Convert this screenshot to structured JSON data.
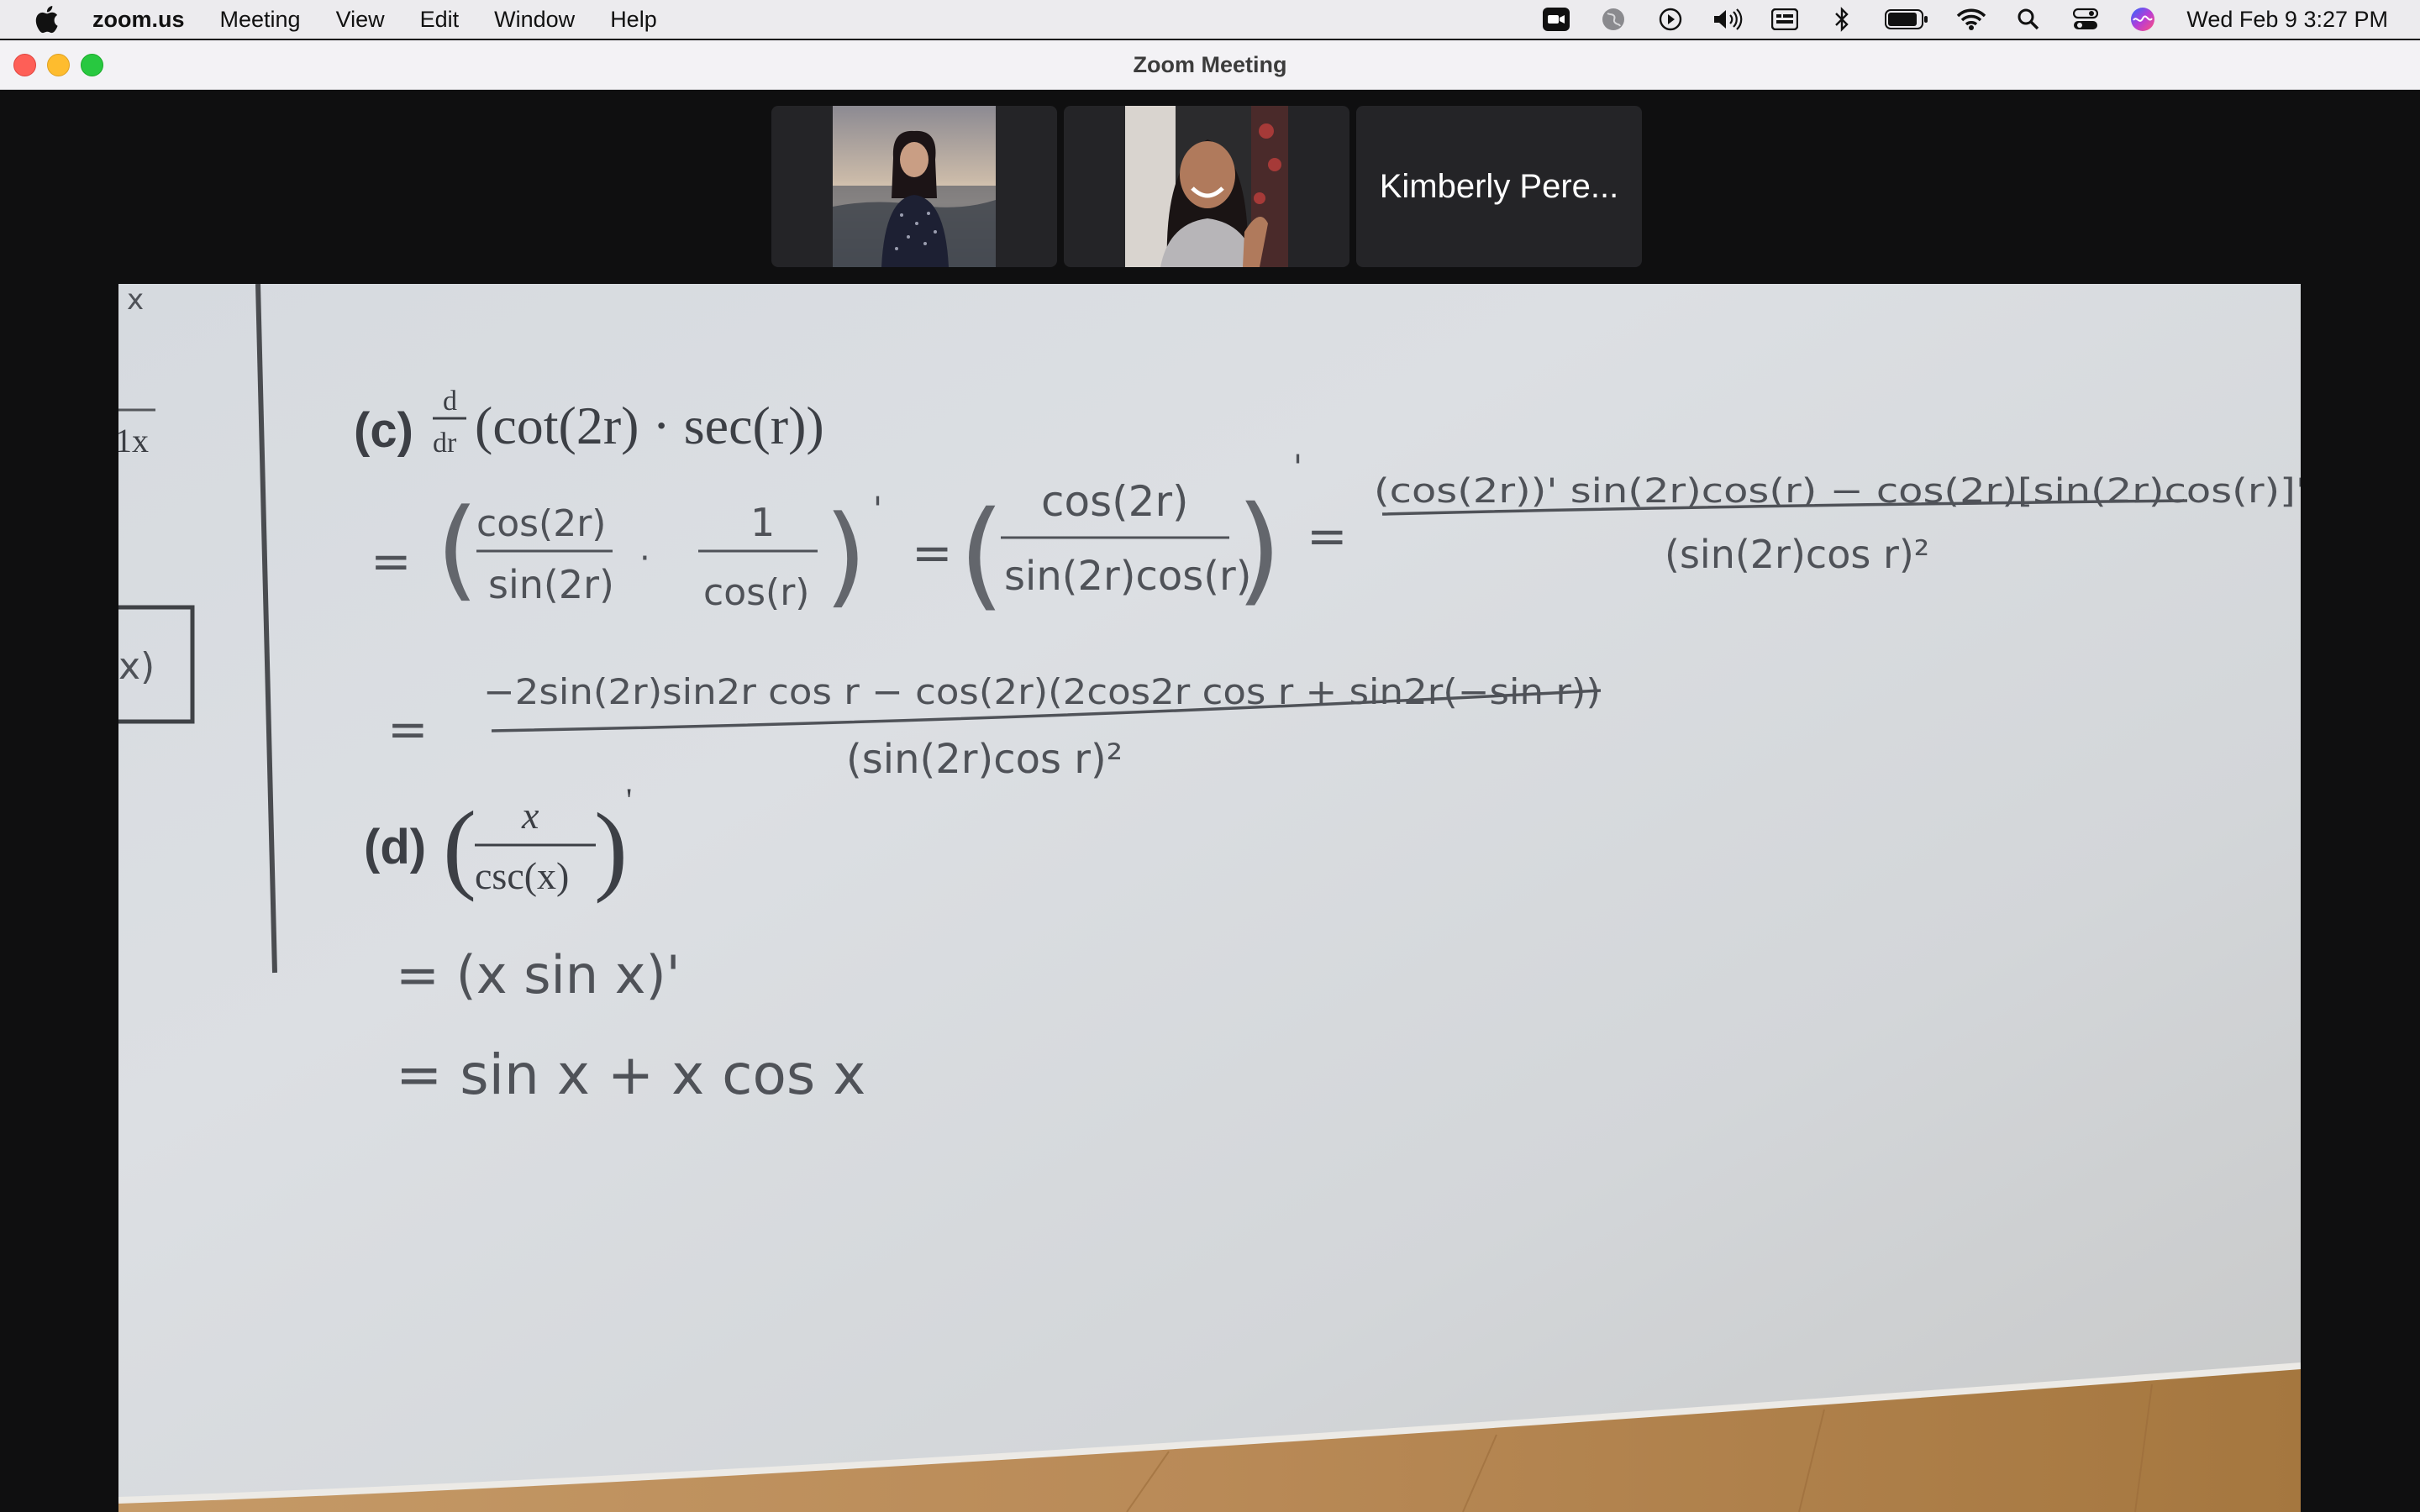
{
  "menubar": {
    "app_name": "zoom.us",
    "items": [
      "Meeting",
      "View",
      "Edit",
      "Window",
      "Help"
    ],
    "clock": "Wed Feb 9  3:27 PM",
    "status_icons": [
      "zoom-video-icon",
      "globe-icon",
      "play-icon",
      "volume-icon",
      "input-menu-icon",
      "bluetooth-icon",
      "battery-icon",
      "wifi-icon",
      "spotlight-search-icon",
      "control-center-icon",
      "siri-icon"
    ]
  },
  "window": {
    "title": "Zoom Meeting"
  },
  "participants": [
    {
      "type": "video",
      "name": ""
    },
    {
      "type": "video",
      "name": ""
    },
    {
      "type": "name",
      "name": "Kimberly Pere..."
    }
  ],
  "shared_screen": {
    "left_margin_fragments": [
      "x",
      "1x",
      "x)"
    ],
    "problem_c": {
      "label": "(c)",
      "derivative": "d/dr",
      "expression": "(cot(2r) · sec(r))",
      "line1_a": "= ( cos(2r) / sin(2r) · 1 / cos(r) )'",
      "line1_b": "= ( cos(2r) / sin(2r)cos(r) )'",
      "line1_c_num": "(cos(2r))' sin(2r)cos(r) − cos(2r)[sin(2r)cos(r)]'",
      "line1_c_den": "(sin(2r)cos r)²",
      "line2_num": "−2sin(2r)sin2r cos r − cos(2r)(2cos2r cos r + sin2r(−sin r))",
      "line2_den": "(sin(2r)cos r)²"
    },
    "problem_d": {
      "label": "(d)",
      "expression_num": "x",
      "expression_den": "csc(x)",
      "step1": "= (x sin x)'",
      "step2": "=  sin x + x cos x"
    }
  },
  "colors": {
    "menubar_bg": "#ecebee",
    "titlebar_bg": "#f3f2f5",
    "app_bg": "#0f0f10",
    "tile_bg": "#242427",
    "close": "#fe5f57",
    "minimize": "#febc2e",
    "maximize": "#28c840"
  }
}
